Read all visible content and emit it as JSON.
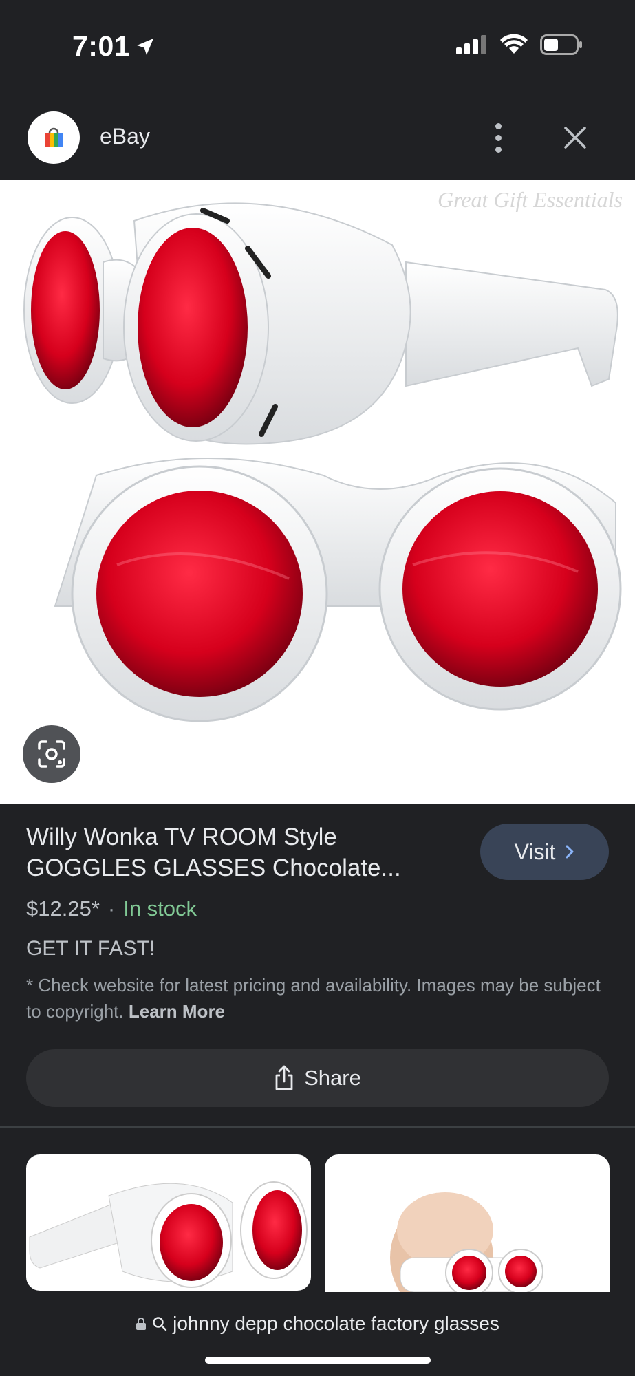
{
  "status_bar": {
    "time": "7:01",
    "icons": [
      "location-arrow-icon",
      "signal-icon",
      "wifi-icon",
      "battery-icon"
    ]
  },
  "source": {
    "name": "eBay",
    "logo_icon": "shopping-bag-icon"
  },
  "header_actions": [
    "more-vertical-icon",
    "close-icon"
  ],
  "image": {
    "watermark": "Great Gift Essentials"
  },
  "product": {
    "title_line1": "Willy Wonka TV ROOM Style",
    "title_line2": "GOGGLES GLASSES Chocolate...",
    "price": "$12.25*",
    "separator": "·",
    "stock": "In stock",
    "tagline": "GET IT FAST!",
    "disclaimer": "* Check website for latest pricing and availability. Images may be subject to copyright.",
    "learn_more": "Learn More"
  },
  "buttons": {
    "visit": "Visit",
    "share": "Share"
  },
  "url_bar": {
    "query": "johnny depp chocolate factory glasses"
  },
  "colors": {
    "background": "#202124",
    "visit_button": "#394457",
    "stock_green": "#81c995",
    "lens_red": "#d6001c"
  }
}
